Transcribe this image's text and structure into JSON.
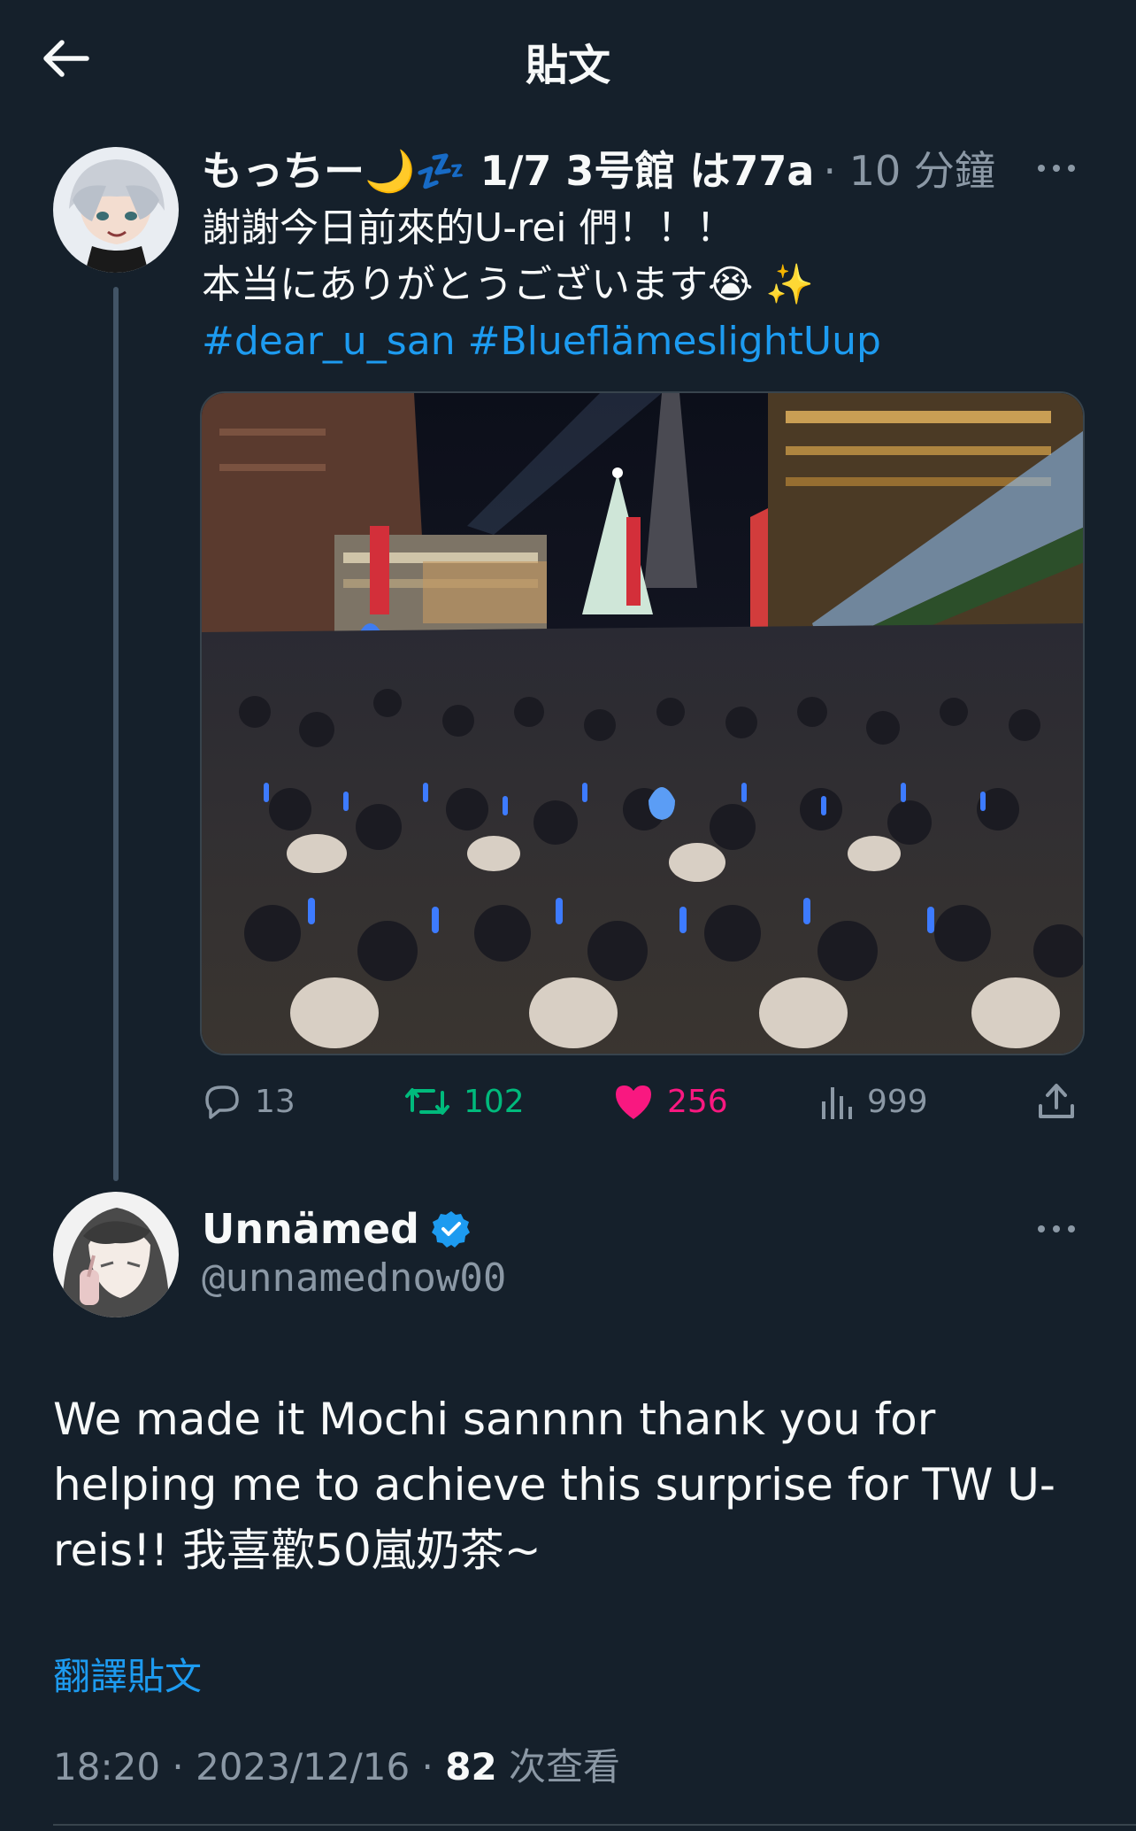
{
  "header": {
    "title": "貼文"
  },
  "post1": {
    "display_name": "もっちー🌙💤 1/7 3号館 は77a",
    "time": "· 10 分鐘",
    "lines": [
      "謝謝今日前來的U-rei 們！！！",
      "本当にありがとうございます😭 ✨"
    ],
    "hashtags": [
      "#dear_u_san",
      "#Blueflämeslight",
      "Uup"
    ],
    "actions": {
      "replies": "13",
      "retweets": "102",
      "likes": "256",
      "views": "999"
    },
    "colors": {
      "retweet": "#00ba7c",
      "like": "#f91880",
      "link": "#1d9bf0"
    }
  },
  "post2": {
    "display_name": "Unnämed",
    "handle": "@unnamednow00",
    "text": "We made it Mochi sannnn thank you for helping me to achieve this surprise for TW U-reis!! 我喜歡50嵐奶茶~",
    "translate": "翻譯貼文",
    "timestamp_prefix": "18:20 · 2023/12/16 · ",
    "view_count": "82",
    "view_label": " 次查看"
  }
}
